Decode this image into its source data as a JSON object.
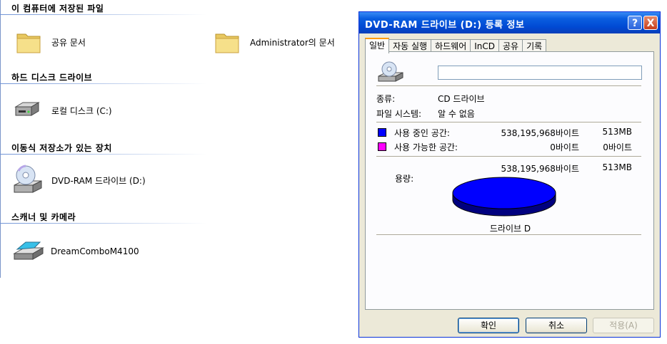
{
  "explorer": {
    "sections": [
      {
        "title": "이 컴퓨터에 저장된 파일"
      },
      {
        "title": "하드 디스크 드라이브"
      },
      {
        "title": "이동식 저장소가 있는 장치"
      },
      {
        "title": "스캐너 및 카메라"
      }
    ],
    "items": {
      "shared_docs": "공유 문서",
      "admin_docs": "Administrator의 문서",
      "local_disk": "로컬 디스크 (C:)",
      "dvd_drive": "DVD-RAM 드라이브 (D:)",
      "scanner": "DreamComboM4100"
    }
  },
  "dialog": {
    "title": "DVD-RAM 드라이브 (D:) 등록 정보",
    "help_button": "?",
    "close_button": "X",
    "tabs": [
      "일반",
      "자동 실행",
      "하드웨어",
      "InCD",
      "공유",
      "기록"
    ],
    "active_tab": "일반",
    "volume_name": "",
    "type_label": "종류:",
    "type_value": "CD 드라이브",
    "fs_label": "파일 시스템:",
    "fs_value": "알 수 없음",
    "used_label": "사용 중인 공간:",
    "used_bytes": "538,195,968바이트",
    "used_size": "513MB",
    "free_label": "사용 가능한 공간:",
    "free_bytes": "0바이트",
    "free_size": "0바이트",
    "capacity_label": "용량:",
    "capacity_bytes": "538,195,968바이트",
    "capacity_size": "513MB",
    "drive_caption": "드라이브 D",
    "ok": "확인",
    "cancel": "취소",
    "apply": "적용(A)",
    "colors": {
      "used": "#0000ff",
      "free": "#ff00ff",
      "titlebar": "#0049d3"
    }
  },
  "chart_data": {
    "type": "pie",
    "categories": [
      "사용 중인 공간",
      "사용 가능한 공간"
    ],
    "values": [
      538195968,
      0
    ],
    "title": "드라이브 D"
  }
}
